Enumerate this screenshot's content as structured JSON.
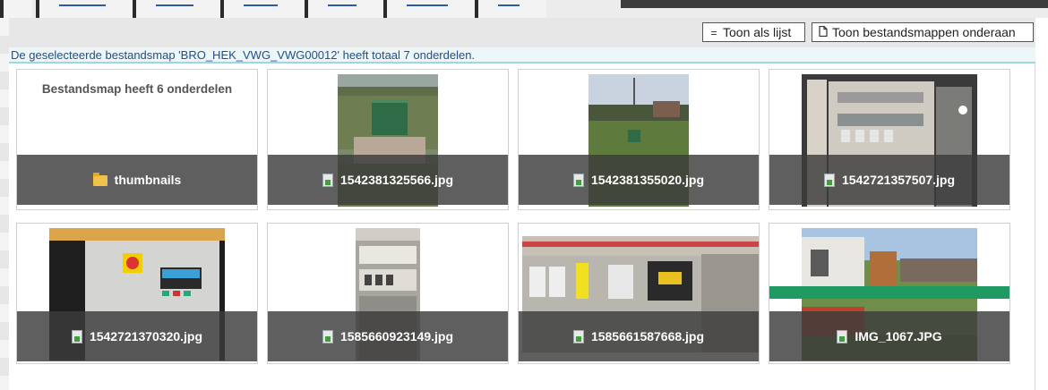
{
  "toolbar": {
    "list_label": "Toon als lijst",
    "list_icon": "list-icon",
    "folders_label": "Toon bestandsmappen onderaan",
    "folders_icon": "document-icon"
  },
  "info": {
    "message": "De geselecteerde bestandsmap 'BRO_HEK_VWG_VWG00012' heeft totaal 7 onderdelen."
  },
  "folder_tile": {
    "title": "Bestandsmap heeft 6 onderdelen",
    "folder_name": "thumbnails",
    "icon": "folder-icon"
  },
  "files": [
    {
      "name": "1542381325566.jpg",
      "icon": "image-file-icon"
    },
    {
      "name": "1542381355020.jpg",
      "icon": "image-file-icon"
    },
    {
      "name": "1542721357507.jpg",
      "icon": "image-file-icon"
    },
    {
      "name": "1542721370320.jpg",
      "icon": "image-file-icon"
    },
    {
      "name": "1585660923149.jpg",
      "icon": "image-file-icon"
    },
    {
      "name": "1585661587668.jpg",
      "icon": "image-file-icon"
    },
    {
      "name": "IMG_1067.JPG",
      "icon": "image-file-icon"
    }
  ]
}
